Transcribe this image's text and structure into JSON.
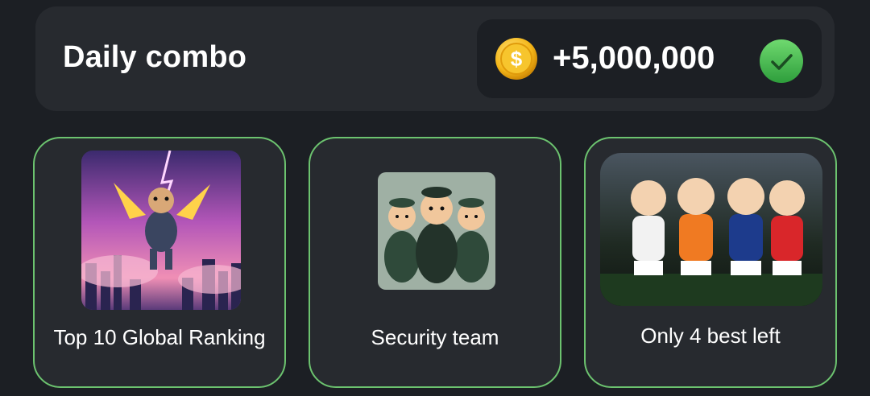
{
  "header": {
    "title": "Daily combo",
    "reward_amount": "+5,000,000",
    "coin_icon": "gold-coin-dollar-icon",
    "check_icon": "check-icon",
    "accent_color": "#4caf50"
  },
  "cards": [
    {
      "label": "Top 10 Global Ranking",
      "image": "winged-hamster-over-city"
    },
    {
      "label": "Security team",
      "image": "hamster-security-team"
    },
    {
      "label": "Only 4 best left",
      "image": "four-hamsters-football-kit"
    }
  ],
  "colors": {
    "background": "#1c1f24",
    "panel": "#272a2f",
    "card_border": "#6cc36f"
  }
}
